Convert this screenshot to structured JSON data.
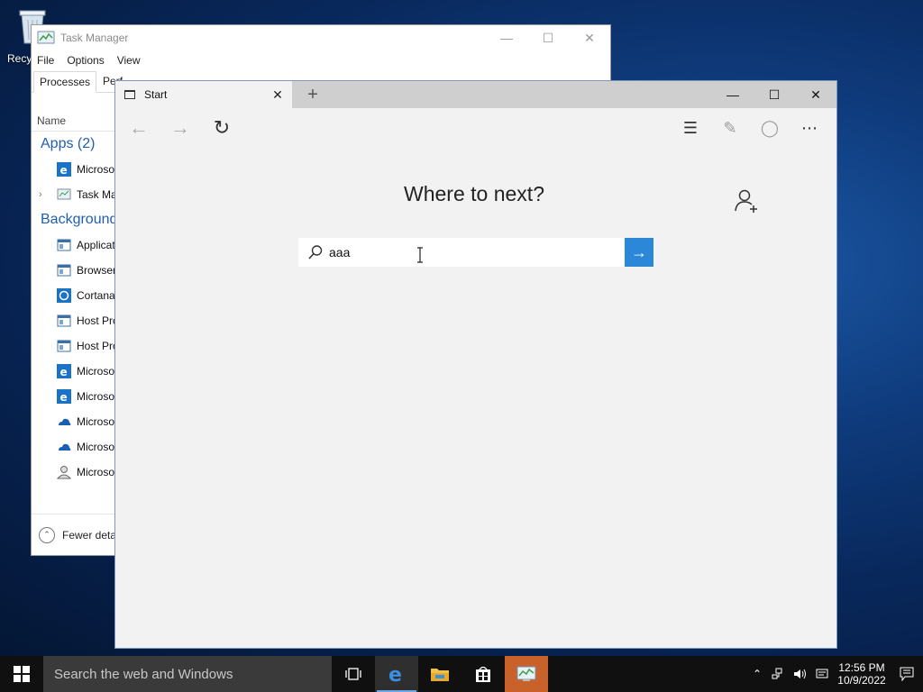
{
  "desktop": {
    "recycle_label": "Recy"
  },
  "taskmgr": {
    "title": "Task Manager",
    "menu": [
      "File",
      "Options",
      "View"
    ],
    "tabs": [
      "Processes",
      "Perf"
    ],
    "column_name": "Name",
    "apps_group": "Apps (2)",
    "apps": [
      "Microso",
      "Task Ma"
    ],
    "bg_group": "Background",
    "bg": [
      "Applicat",
      "Browser",
      "Cortana",
      "Host Pro",
      "Host Pro",
      "Microso",
      "Microso",
      "Microso",
      "Microso",
      "Microso"
    ],
    "fewer": "Fewer detai"
  },
  "edge": {
    "tab_title": "Start",
    "headline": "Where to next?",
    "search_value": "aaa"
  },
  "taskbar": {
    "search_placeholder": "Search the web and Windows",
    "time": "12:56 PM",
    "date": "10/9/2022"
  },
  "colors": {
    "accent": "#2b88d8",
    "taskbar": "#101010",
    "highlight_app": "#c9622a"
  }
}
